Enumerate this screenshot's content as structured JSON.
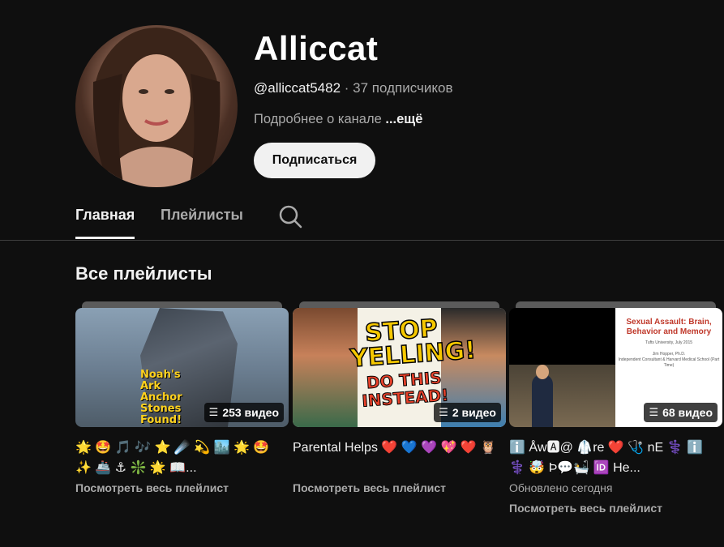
{
  "channel": {
    "name": "Alliccat",
    "handle": "@alliccat5482",
    "separator": " · ",
    "subscribers": "37 подписчиков",
    "about": "Подробнее о канале",
    "about_more": "...ещё",
    "subscribe_label": "Подписаться"
  },
  "tabs": [
    {
      "label": "Главная",
      "active": true
    },
    {
      "label": "Плейлисты",
      "active": false
    }
  ],
  "section_title": "Все плейлисты",
  "playlists": [
    {
      "title": "🌟 🤩 🎵 🎶 ⭐ ☄️ 💫 🏙️ 🌟 🤩 ✨ 🚢 ⚓ ❇️ 🌟 📖...",
      "count": "253 видео",
      "updated": "",
      "link": "Посмотреть весь плейлист",
      "thumb_text": "Noah's Ark Anchor Stones Found!"
    },
    {
      "title": "Parental Helps ❤️ 💙 💜 💖 ❤️ 🦉",
      "count": "2 видео",
      "updated": "",
      "link": "Посмотреть весь плейлист",
      "thumb_text_1": "STOP YELLING!",
      "thumb_text_2": "DO THIS INSTEAD!"
    },
    {
      "title": "ℹ️ Åw🅰@ 🥼re ❤️ 🩺 nE ⚕️ ℹ️ ⚕️ 🤯 Þ💬🛀 🆔 He...",
      "count": "68 видео",
      "updated": "Обновлено сегодня",
      "link": "Посмотреть весь плейлист",
      "slide_title": "Sexual Assault: Brain, Behavior and Memory",
      "slide_sub": "Tufts University, July 2015",
      "slide_author": "Jim Hopper, Ph.D.",
      "slide_aff": "Independent Consultant & Harvard Medical School (Part Time)"
    }
  ],
  "icons": {
    "search": "search-icon",
    "playlist": "playlist-icon"
  },
  "colors": {
    "background": "#0f0f0f",
    "text": "#f1f1f1",
    "secondary": "#aaaaaa",
    "subscribe_bg": "#f1f1f1"
  }
}
